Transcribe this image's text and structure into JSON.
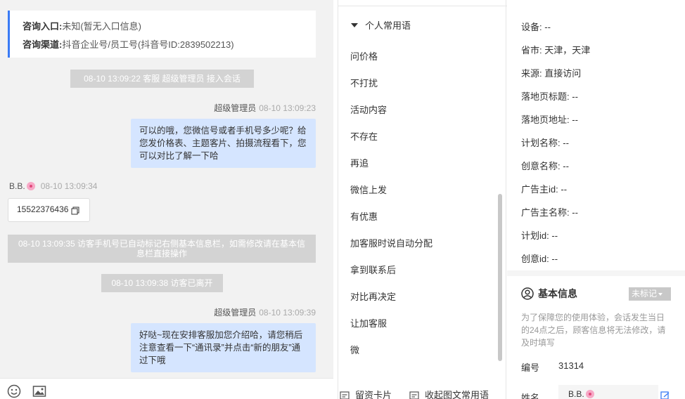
{
  "chat": {
    "source_card": {
      "entry_label": "咨询入口:",
      "entry_value": "未知(暂无入口信息)",
      "channel_label": "咨询渠道:",
      "channel_value": "抖音企业号/员工号(抖音号ID:2839502213)"
    },
    "messages": [
      {
        "type": "system",
        "text": "08-10 13:09:22 客服 超级管理员 接入会话"
      },
      {
        "sender": "超级管理员",
        "time": "08-10 13:09:23",
        "side": "right",
        "text": "可以的哦，您微信号或者手机号多少呢？给您发价格表、主题客片、拍摄流程看下，您可以对比了解一下哈"
      },
      {
        "sender": "B.B.",
        "time": "08-10 13:09:34",
        "side": "left",
        "text": "15522376436"
      },
      {
        "type": "system",
        "text": "08-10 13:09:35 访客手机号已自动标记右侧基本信息栏，如需修改请在基本信息栏直接操作"
      },
      {
        "type": "system",
        "text": "08-10 13:09:38 访客已离开"
      },
      {
        "sender": "超级管理员",
        "time": "08-10 13:09:39",
        "side": "right",
        "text": "好哒~现在安排客服加您介绍哈，请您稍后注意查看一下“通讯录”并点击“新的朋友”通过下哦"
      }
    ],
    "tools": {
      "emoji_icon": "smile-icon",
      "image_icon": "image-icon"
    }
  },
  "phrases": {
    "group_title": "个人常用语",
    "items": [
      "问价格",
      "不打扰",
      "活动内容",
      "不存在",
      "再追",
      "微信上发",
      "有优惠",
      "加客服时说自动分配",
      "拿到联系后",
      "对比再决定",
      "让加客服",
      "微"
    ],
    "footer": {
      "card_label": "留资卡片",
      "collapse_label": "收起图文常用语"
    }
  },
  "info": {
    "source_rows": [
      {
        "label": "设备:",
        "value": "--"
      },
      {
        "label": "省市:",
        "value": "天津，天津"
      },
      {
        "label": "来源:",
        "value": "直接访问"
      },
      {
        "label": "落地页标题:",
        "value": "--"
      },
      {
        "label": "落地页地址:",
        "value": "--"
      },
      {
        "label": "计划名称:",
        "value": "--"
      },
      {
        "label": "创意名称:",
        "value": "--"
      },
      {
        "label": "广告主id:",
        "value": "--"
      },
      {
        "label": "广告主名称:",
        "value": "--"
      },
      {
        "label": "计划id:",
        "value": "--"
      },
      {
        "label": "创意id:",
        "value": "--"
      }
    ],
    "basic": {
      "title": "基本信息",
      "tag_label": "未标记",
      "note": "为了保障您的使用体验，会话发生当日的24点之后，顾客信息将无法修改，请及时填写",
      "id_label": "编号",
      "id_value": "31314",
      "name_label": "姓名",
      "name_value": "B.B."
    }
  },
  "colors": {
    "accent": "#3a7bf5",
    "bubble": "#d5e5ff",
    "system_bg": "#d3d3d3",
    "tag_bg": "#c8c8c8"
  }
}
